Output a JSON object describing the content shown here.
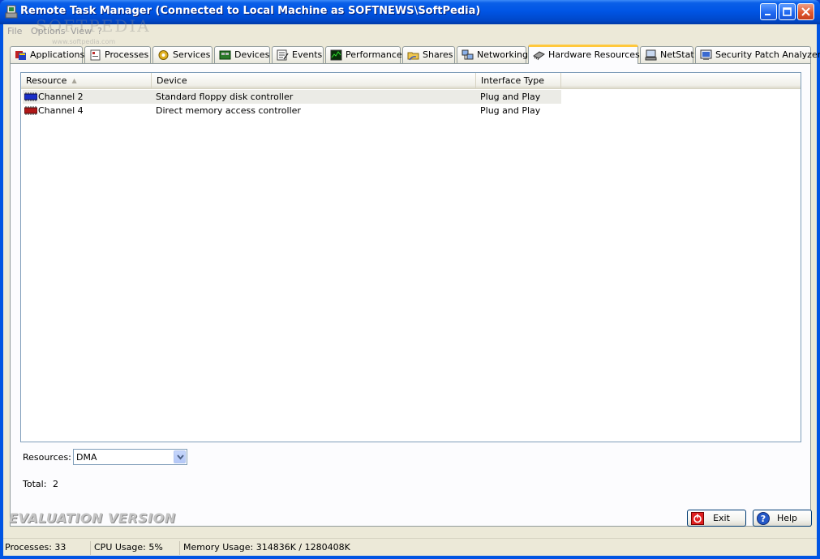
{
  "window": {
    "title": "Remote Task Manager (Connected to Local Machine as SOFTNEWS\\SoftPedia)",
    "watermark": "SOFTPEDIA",
    "watermark_url": "www.softpedia.com"
  },
  "menu": [
    "File",
    "Options",
    "View",
    "?"
  ],
  "tabs": [
    {
      "label": "Applications",
      "icon": "applications-icon"
    },
    {
      "label": "Processes",
      "icon": "processes-icon"
    },
    {
      "label": "Services",
      "icon": "services-icon"
    },
    {
      "label": "Devices",
      "icon": "devices-icon"
    },
    {
      "label": "Events",
      "icon": "events-icon"
    },
    {
      "label": "Performance",
      "icon": "performance-icon"
    },
    {
      "label": "Shares",
      "icon": "shares-icon"
    },
    {
      "label": "Networking",
      "icon": "networking-icon"
    },
    {
      "label": "Hardware Resources",
      "icon": "hardware-icon",
      "active": true
    },
    {
      "label": "NetStat",
      "icon": "netstat-icon"
    },
    {
      "label": "Security Patch Analyzer",
      "icon": "security-patch-icon"
    }
  ],
  "list": {
    "columns": [
      "Resource",
      "Device",
      "Interface Type"
    ],
    "rows": [
      {
        "resource": "Channel 2",
        "device": "Standard floppy disk controller",
        "interface": "Plug and Play",
        "chip_color": "#1a2fc8"
      },
      {
        "resource": "Channel 4",
        "device": "Direct memory access controller",
        "interface": "Plug and Play",
        "chip_color": "#b01818"
      }
    ]
  },
  "filter": {
    "label": "Resources:",
    "value": "DMA"
  },
  "total": {
    "label": "Total:",
    "value": "2"
  },
  "evaluation": "EVALUATION VERSION",
  "buttons": {
    "exit": "Exit",
    "help": "Help"
  },
  "status": {
    "processes": "Processes: 33",
    "cpu": "CPU Usage: 5%",
    "memory": "Memory Usage: 314836K / 1280408K"
  }
}
